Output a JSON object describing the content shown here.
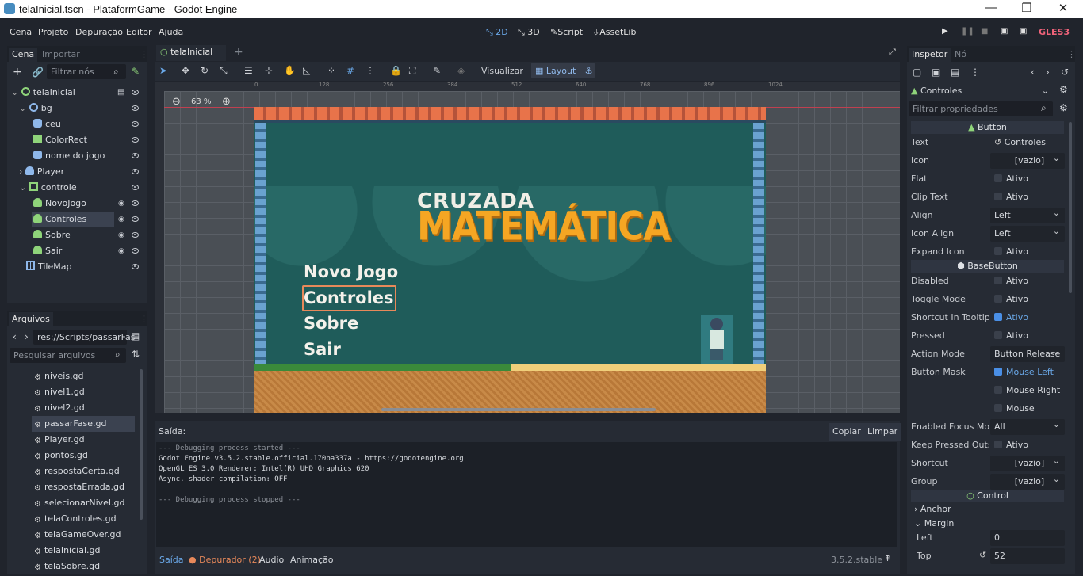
{
  "window": {
    "title": "telaInicial.tscn - PlataformGame - Godot Engine",
    "minimize": "—",
    "restore": "❐",
    "close": "✕"
  },
  "menu": [
    "Cena",
    "Projeto",
    "Depuração",
    "Editor",
    "Ajuda"
  ],
  "workspaces": [
    "2D",
    "3D",
    "Script",
    "AssetLib"
  ],
  "renderer": "GLES3",
  "scene_dock": {
    "tabs": [
      "Cena",
      "Importar"
    ],
    "filter_placeholder": "Filtrar nós",
    "nodes": [
      {
        "label": "telaInicial",
        "icon": "control-node-icon"
      },
      {
        "label": "bg",
        "icon": "node2d-icon"
      },
      {
        "label": "ceu",
        "icon": "sprite-icon"
      },
      {
        "label": "ColorRect",
        "icon": "colorrect-icon"
      },
      {
        "label": "nome do jogo",
        "icon": "sprite-icon"
      },
      {
        "label": "Player",
        "icon": "kinematic-icon"
      },
      {
        "label": "controle",
        "icon": "vboxcontainer-icon"
      },
      {
        "label": "NovoJogo",
        "icon": "button-icon"
      },
      {
        "label": "Controles",
        "icon": "button-icon"
      },
      {
        "label": "Sobre",
        "icon": "button-icon"
      },
      {
        "label": "Sair",
        "icon": "button-icon"
      },
      {
        "label": "TileMap",
        "icon": "tilemap-icon"
      }
    ]
  },
  "files_dock": {
    "tab": "Arquivos",
    "path": "res://Scripts/passarFas",
    "search_placeholder": "Pesquisar arquivos",
    "files": [
      "niveis.gd",
      "nivel1.gd",
      "nivel2.gd",
      "passarFase.gd",
      "Player.gd",
      "pontos.gd",
      "respostaCerta.gd",
      "respostaErrada.gd",
      "selecionarNivel.gd",
      "telaControles.gd",
      "telaGameOver.gd",
      "telaInicial.gd",
      "telaSobre.gd"
    ],
    "selected": "passarFase.gd"
  },
  "editor": {
    "scene_tab": "telaInicial",
    "add_tab": "+",
    "zoom": "63 %",
    "toolbar_view": "Visualizar",
    "toolbar_layout": "Layout",
    "ruler": [
      "0",
      "128",
      "256",
      "384",
      "512",
      "640",
      "768",
      "896",
      "1024"
    ],
    "game_title_top": "CRUZADA",
    "game_title_bottom": "MATEMÁTICA",
    "buttons": [
      "Novo Jogo",
      "Controles",
      "Sobre",
      "Sair"
    ]
  },
  "output": {
    "label": "Saída:",
    "copy": "Copiar",
    "clear": "Limpar",
    "lines": [
      "--- Debugging process started ---",
      "Godot Engine v3.5.2.stable.official.170ba337a - https://godotengine.org",
      "OpenGL ES 3.0 Renderer: Intel(R) UHD Graphics 620",
      "Async. shader compilation: OFF",
      "",
      "--- Debugging process stopped ---"
    ],
    "bottom_tabs": [
      "Saída",
      "Depurador (2)",
      "Áudio",
      "Animação"
    ],
    "version": "3.5.2.stable"
  },
  "inspector": {
    "tabs": [
      "Inspetor",
      "Nó"
    ],
    "node": "Controles",
    "filter_placeholder": "Filtrar propriedades",
    "sections": [
      "Button",
      "BaseButton",
      "Control"
    ],
    "props_button": [
      {
        "k": "Text",
        "v": "Controles"
      },
      {
        "k": "Icon",
        "v": "[vazio]"
      },
      {
        "k": "Flat",
        "v": "Ativo"
      },
      {
        "k": "Clip Text",
        "v": "Ativo"
      },
      {
        "k": "Align",
        "v": "Left"
      },
      {
        "k": "Icon Align",
        "v": "Left"
      },
      {
        "k": "Expand Icon",
        "v": "Ativo"
      }
    ],
    "props_base": [
      {
        "k": "Disabled",
        "v": "Ativo"
      },
      {
        "k": "Toggle Mode",
        "v": "Ativo"
      },
      {
        "k": "Shortcut In Tooltip",
        "v": "Ativo"
      },
      {
        "k": "Pressed",
        "v": "Ativo"
      },
      {
        "k": "Action Mode",
        "v": "Button Release"
      },
      {
        "k": "Button Mask",
        "v": "Mouse Left"
      },
      {
        "k": "",
        "v": "Mouse Right"
      },
      {
        "k": "",
        "v": "Mouse Middle"
      },
      {
        "k": "Enabled Focus Mod",
        "v": "All"
      },
      {
        "k": "Keep Pressed Outsi",
        "v": "Ativo"
      },
      {
        "k": "Shortcut",
        "v": "[vazio]"
      },
      {
        "k": "Group",
        "v": "[vazio]"
      }
    ],
    "control": {
      "anchor": "Anchor",
      "margin": "Margin",
      "left_k": "Left",
      "left_v": "0",
      "top_k": "Top",
      "top_v": "52"
    }
  },
  "colors": {
    "accent": "#6aa8e8",
    "bg_dark": "#20242c",
    "panel": "#262b34",
    "teal": "#1f5c5a",
    "orange": "#f5a623"
  }
}
